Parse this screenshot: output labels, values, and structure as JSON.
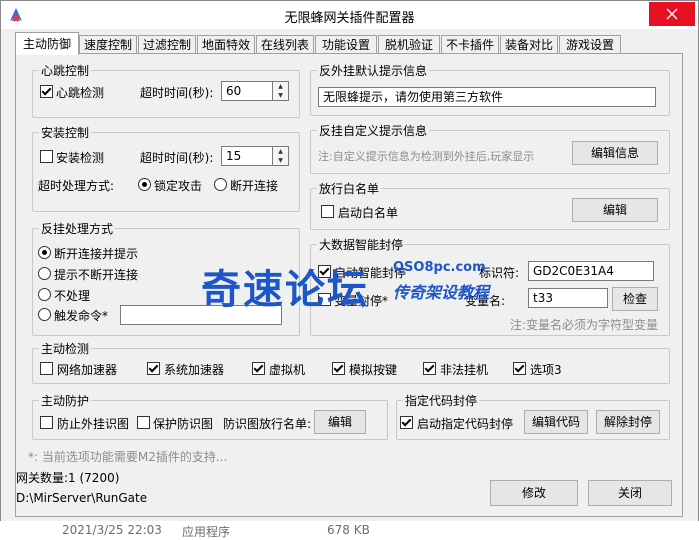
{
  "window": {
    "title": "无限蜂网关插件配置器"
  },
  "tabs": [
    "主动防御",
    "速度控制",
    "过滤控制",
    "地面特效",
    "在线列表",
    "功能设置",
    "脱机验证",
    "不卡插件",
    "装备对比",
    "游戏设置"
  ],
  "heartbeat": {
    "legend": "心跳控制",
    "check_label": "心跳检测",
    "timeout_label": "超时时间(秒):",
    "timeout_value": "60"
  },
  "install": {
    "legend": "安装控制",
    "check_label": "安装检测",
    "timeout_label": "超时时间(秒):",
    "timeout_value": "15",
    "mode_label": "超时处理方式:",
    "lock_label": "锁定攻击",
    "disconnect_label": "断开连接"
  },
  "anticheat_mode": {
    "legend": "反挂处理方式",
    "opt1": "断开连接并提示",
    "opt2": "提示不断开连接",
    "opt3": "不处理",
    "opt4": "触发命令*"
  },
  "default_tip": {
    "legend": "反外挂默认提示信息",
    "value": "无限蜂提示，请勿使用第三方软件"
  },
  "custom_tip": {
    "legend": "反挂自定义提示信息",
    "note": "注:自定义提示信息为检测到外挂后,玩家显示",
    "button": "编辑信息"
  },
  "whitelist": {
    "legend": "放行白名单",
    "check_label": "启动白名单",
    "button": "编辑"
  },
  "bigdata": {
    "legend": "大数据智能封停",
    "check_label": "启动智能封停",
    "ident_label": "标识符:",
    "ident_value": "GD2C0E31A4",
    "var_check_label": "变量封停*",
    "var_label": "变量名:",
    "var_value": "t33",
    "check_button": "检查",
    "note": "注:变量名必须为字符型变量"
  },
  "active_detect": {
    "legend": "主动检测",
    "items": [
      "网络加速器",
      "系统加速器",
      "虚拟机",
      "模拟按键",
      "非法挂机",
      "选项3"
    ]
  },
  "active_protect": {
    "legend": "主动防护",
    "anti_plugin_label": "防止外挂识图",
    "protect_label": "保护防识图",
    "whitelist_label": "防识图放行名单:",
    "button": "编辑"
  },
  "code_ban": {
    "legend": "指定代码封停",
    "check_label": "启动指定代码封停",
    "edit_button": "编辑代码",
    "release_button": "解除封停"
  },
  "footer": {
    "note": "*: 当前选项功能需要M2插件的支持...",
    "gateway_count": "网关数量:1 (7200)",
    "path": "D:\\MirServer\\RunGate",
    "modify_button": "修改",
    "close_button": "关闭"
  },
  "statusbar": {
    "date": "2021/3/25 22:03",
    "type": "应用程序",
    "size": "678 KB"
  },
  "watermark": {
    "main": "奇速论坛",
    "site": "QSO8pc.com",
    "sub": "传奇架设教程"
  }
}
